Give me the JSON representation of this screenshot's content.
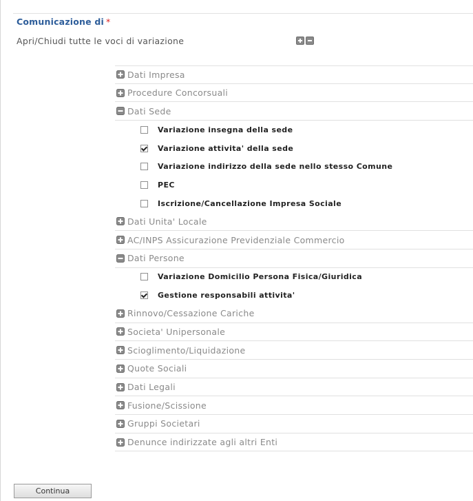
{
  "header": {
    "title": "Comunicazione di",
    "required_mark": "*",
    "subtitle": "Apri/Chiudi tutte le voci di variazione"
  },
  "colors": {
    "title": "#2d5d9a",
    "required": "#dd2222",
    "section_text": "#8a8a8a",
    "icon": "#8a8a8a"
  },
  "sections": [
    {
      "label": "Dati Impresa",
      "expanded": false
    },
    {
      "label": "Procedure Concorsuali",
      "expanded": false
    },
    {
      "label": "Dati Sede",
      "expanded": true,
      "items": [
        {
          "label": "Variazione insegna della sede",
          "checked": false
        },
        {
          "label": "Variazione attivita' della sede",
          "checked": true
        },
        {
          "label": "Variazione indirizzo della sede nello stesso Comune",
          "checked": false
        },
        {
          "label": "PEC",
          "checked": false
        },
        {
          "label": "Iscrizione/Cancellazione Impresa Sociale",
          "checked": false
        }
      ]
    },
    {
      "label": "Dati Unita' Locale",
      "expanded": false
    },
    {
      "label": "AC/INPS Assicurazione Previdenziale Commercio",
      "expanded": false
    },
    {
      "label": "Dati Persone",
      "expanded": true,
      "items": [
        {
          "label": "Variazione Domicilio Persona Fisica/Giuridica",
          "checked": false
        },
        {
          "label": "Gestione responsabili attivita'",
          "checked": true
        }
      ]
    },
    {
      "label": "Rinnovo/Cessazione Cariche",
      "expanded": false
    },
    {
      "label": "Societa' Unipersonale",
      "expanded": false
    },
    {
      "label": "Scioglimento/Liquidazione",
      "expanded": false
    },
    {
      "label": "Quote Sociali",
      "expanded": false
    },
    {
      "label": "Dati Legali",
      "expanded": false
    },
    {
      "label": "Fusione/Scissione",
      "expanded": false
    },
    {
      "label": "Gruppi Societari",
      "expanded": false
    },
    {
      "label": "Denunce indirizzate agli altri Enti",
      "expanded": false
    }
  ],
  "footer": {
    "continue_label": "Continua"
  }
}
